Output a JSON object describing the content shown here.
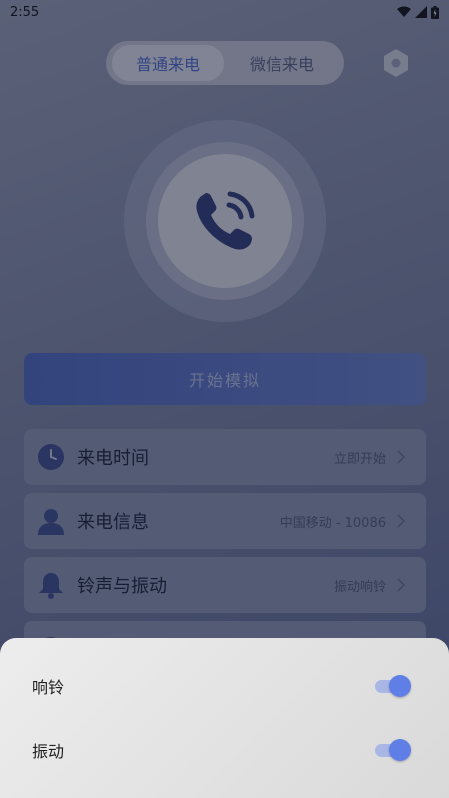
{
  "status_bar": {
    "time": "2:55"
  },
  "mode_tabs": [
    {
      "label": "普通来电",
      "active": true
    },
    {
      "label": "微信来电",
      "active": false
    }
  ],
  "icons": {
    "settings": "hexagon-settings-icon",
    "call": "phone-ringing-icon",
    "time": "clock-icon",
    "info": "person-icon",
    "ringtone": "bell-icon",
    "chevron": "chevron-right-icon"
  },
  "start_button": {
    "label": "开始模拟"
  },
  "settings_rows": [
    {
      "title": "来电时间",
      "value": "立即开始"
    },
    {
      "title": "来电信息",
      "value": "中国移动 - 10086"
    },
    {
      "title": "铃声与振动",
      "value": "振动响铃"
    }
  ],
  "bottom_sheet": {
    "toggles": [
      {
        "label": "响铃",
        "on": true
      },
      {
        "label": "振动",
        "on": true
      }
    ]
  },
  "colors": {
    "accent": "#5f7fe6",
    "primary_button": "#4f6bc4",
    "overlay": "#141a30"
  }
}
